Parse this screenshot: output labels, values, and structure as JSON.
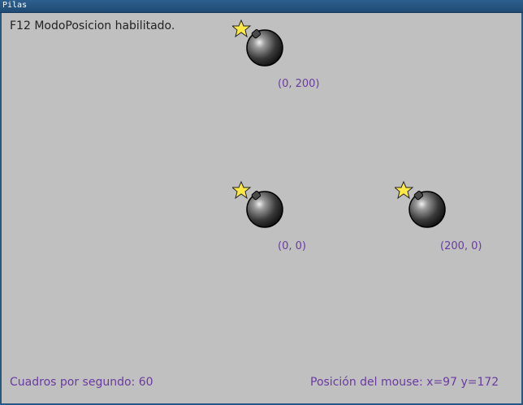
{
  "window": {
    "title": "Pilas"
  },
  "status": {
    "mode_message": "F12 ModoPosicion habilitado.",
    "fps_text": "Cuadros por segundo: 60",
    "mouse_text": "Posición del mouse: x=97 y=172"
  },
  "actors": [
    {
      "icon": "bomb-icon",
      "label": "(0, 200)"
    },
    {
      "icon": "bomb-icon",
      "label": "(0, 0)"
    },
    {
      "icon": "bomb-icon",
      "label": "(200, 0)"
    }
  ],
  "colors": {
    "background": "#c0c0c0",
    "coordinate_text": "#6a3aa0",
    "title_bar": "#2a5680"
  }
}
